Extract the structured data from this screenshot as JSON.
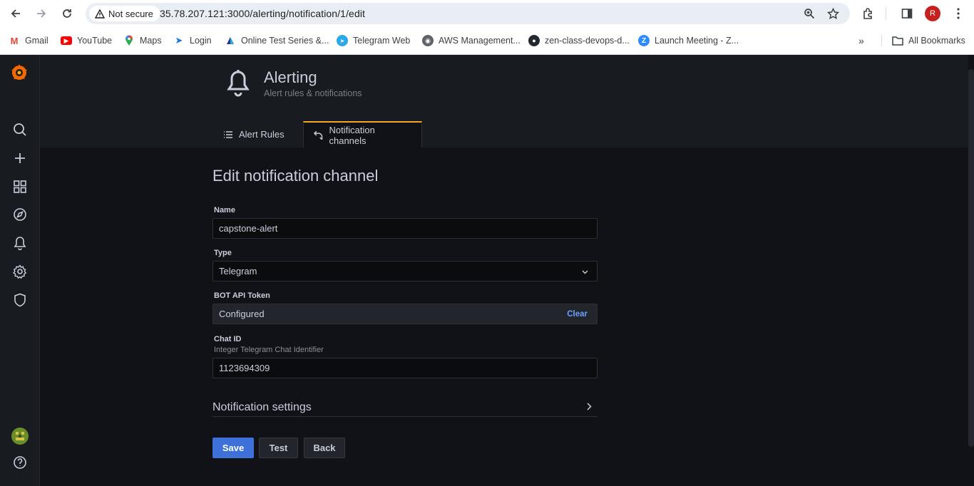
{
  "browser": {
    "security_label": "Not secure",
    "url": "35.78.207.121:3000/alerting/notification/1/edit",
    "profile_initial": "R",
    "bookmarks": [
      {
        "label": "Gmail",
        "icon": "gmail-icon"
      },
      {
        "label": "YouTube",
        "icon": "youtube-icon"
      },
      {
        "label": "Maps",
        "icon": "maps-icon"
      },
      {
        "label": "Login",
        "icon": "login-icon"
      },
      {
        "label": "Online Test Series &...",
        "icon": "test-series-icon"
      },
      {
        "label": "Telegram Web",
        "icon": "telegram-icon"
      },
      {
        "label": "AWS Management...",
        "icon": "aws-icon"
      },
      {
        "label": "zen-class-devops-d...",
        "icon": "github-icon"
      },
      {
        "label": "Launch Meeting - Z...",
        "icon": "zoom-icon"
      }
    ],
    "all_bookmarks_label": "All Bookmarks"
  },
  "header": {
    "title": "Alerting",
    "subtitle": "Alert rules & notifications",
    "tabs": [
      {
        "label": "Alert Rules",
        "active": false
      },
      {
        "label": "Notification channels",
        "active": true
      }
    ]
  },
  "form": {
    "heading": "Edit notification channel",
    "name_label": "Name",
    "name_value": "capstone-alert",
    "type_label": "Type",
    "type_value": "Telegram",
    "token_label": "BOT API Token",
    "token_value": "Configured",
    "token_clear": "Clear",
    "chat_label": "Chat ID",
    "chat_desc": "Integer Telegram Chat Identifier",
    "chat_value": "1123694309",
    "settings_label": "Notification settings"
  },
  "buttons": {
    "save": "Save",
    "test": "Test",
    "back": "Back"
  },
  "colors": {
    "primary": "#3d71d9",
    "tab_accent": "#f6a623",
    "background": "#111217"
  }
}
